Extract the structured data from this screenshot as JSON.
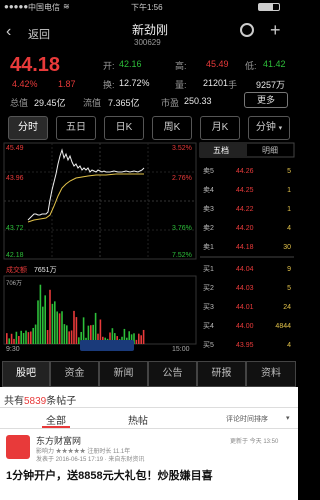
{
  "status_bar": {
    "carrier": "中国电信",
    "time": "下午1:56"
  },
  "header": {
    "back_label": "返回",
    "title": "新劲刚",
    "code": "300629"
  },
  "quote": {
    "price": "44.18",
    "pct": "4.42%",
    "change": "1.87",
    "open_label": "开:",
    "open": "42.16",
    "high_label": "高:",
    "high": "45.49",
    "low_label": "低:",
    "low": "41.42",
    "turnover_label": "换:",
    "turnover": "12.72%",
    "vol_label": "量:",
    "vol": "21201",
    "vol_unit": "手",
    "amount": "9257万",
    "total_cap_label": "总值",
    "total_cap": "29.45亿",
    "float_cap_label": "流值",
    "float_cap": "7.365亿",
    "pe_label": "市盈",
    "pe": "250.33",
    "more_label": "更多"
  },
  "tabs": [
    "分时",
    "五日",
    "日K",
    "周K",
    "月K",
    "分钟"
  ],
  "chart": {
    "price_high": "45.49",
    "price_mid": "43.96",
    "price_low1": "43.72",
    "price_low2": "42.18",
    "pct_top": "3.52%",
    "pct_mid": "2.76%",
    "pct_low1": "3.76%",
    "pct_low2": "7.52%",
    "vol_title": "成交额",
    "vol_val": "7651万",
    "vol_axis": "706万",
    "t_start": "9:30",
    "t_end": "15:00",
    "ob_tab1": "五档",
    "ob_tab2": "明细",
    "sells": [
      {
        "label": "卖5",
        "price": "44.26",
        "vol": "5"
      },
      {
        "label": "卖4",
        "price": "44.25",
        "vol": "1"
      },
      {
        "label": "卖3",
        "price": "44.22",
        "vol": "1"
      },
      {
        "label": "卖2",
        "price": "44.20",
        "vol": "4"
      },
      {
        "label": "卖1",
        "price": "44.18",
        "vol": "30"
      }
    ],
    "buys": [
      {
        "label": "买1",
        "price": "44.04",
        "vol": "9"
      },
      {
        "label": "买2",
        "price": "44.03",
        "vol": "5"
      },
      {
        "label": "买3",
        "price": "44.01",
        "vol": "24"
      },
      {
        "label": "买4",
        "price": "44.00",
        "vol": "4844"
      },
      {
        "label": "买5",
        "price": "43.95",
        "vol": "4"
      }
    ]
  },
  "bottom_nav": [
    "股吧",
    "资金",
    "新闻",
    "公告",
    "研报",
    "资料"
  ],
  "posts": {
    "count_prefix": "共有",
    "count": "5839",
    "count_suffix": "条帖子",
    "tab_all": "全部",
    "tab_hot": "热帖",
    "sort_label": "评论时间排序",
    "author": "东方财富网",
    "author_meta": "影响力 ★★★★★  注册时长 11.1年",
    "time": "更新于 今天 13:50",
    "sub": "发表于 2016-06-15 17:19 · 来自东财资讯",
    "headline": "1分钟开户，送8858元大礼包！炒股嫌目喜"
  },
  "colors": {
    "up": "#e83a3a",
    "down": "#2dbf3a",
    "bg": "#000000",
    "gray": "#9a9a9a",
    "yellow": "#e3c34a"
  }
}
